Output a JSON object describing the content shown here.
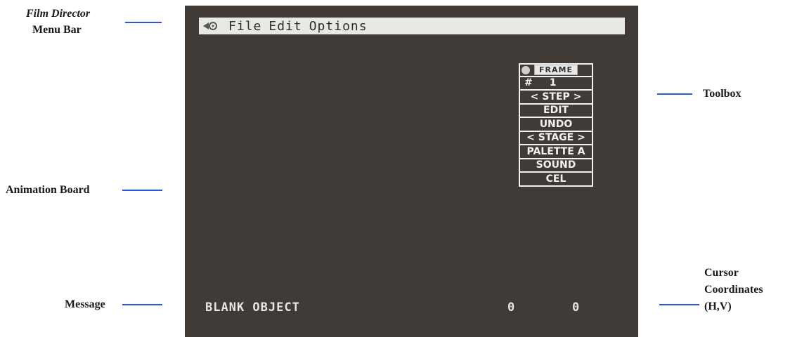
{
  "annotations": {
    "film_director": "Film Director",
    "menu_bar": "Menu Bar",
    "toolbox": "Toolbox",
    "animation_board": "Animation Board",
    "message": "Message",
    "cursor_line1": "Cursor",
    "cursor_line2": "Coordinates",
    "cursor_line3": "(H,V)"
  },
  "menu": {
    "items": [
      "File",
      "Edit",
      "Options"
    ]
  },
  "toolbox": {
    "frame_label": "FRAME",
    "frame_number_prefix": "#",
    "frame_number": "1",
    "step": "< STEP >",
    "edit": "EDIT",
    "undo": "UNDO",
    "stage": "< STAGE >",
    "palette": "PALETTE A",
    "sound": "SOUND",
    "cel": "CEL"
  },
  "status": {
    "message": "BLANK OBJECT",
    "h": "0",
    "v": "0"
  },
  "colors": {
    "screen": "#403b37",
    "menubar": "#e9e9e4",
    "leader": "#2a5bd7"
  }
}
